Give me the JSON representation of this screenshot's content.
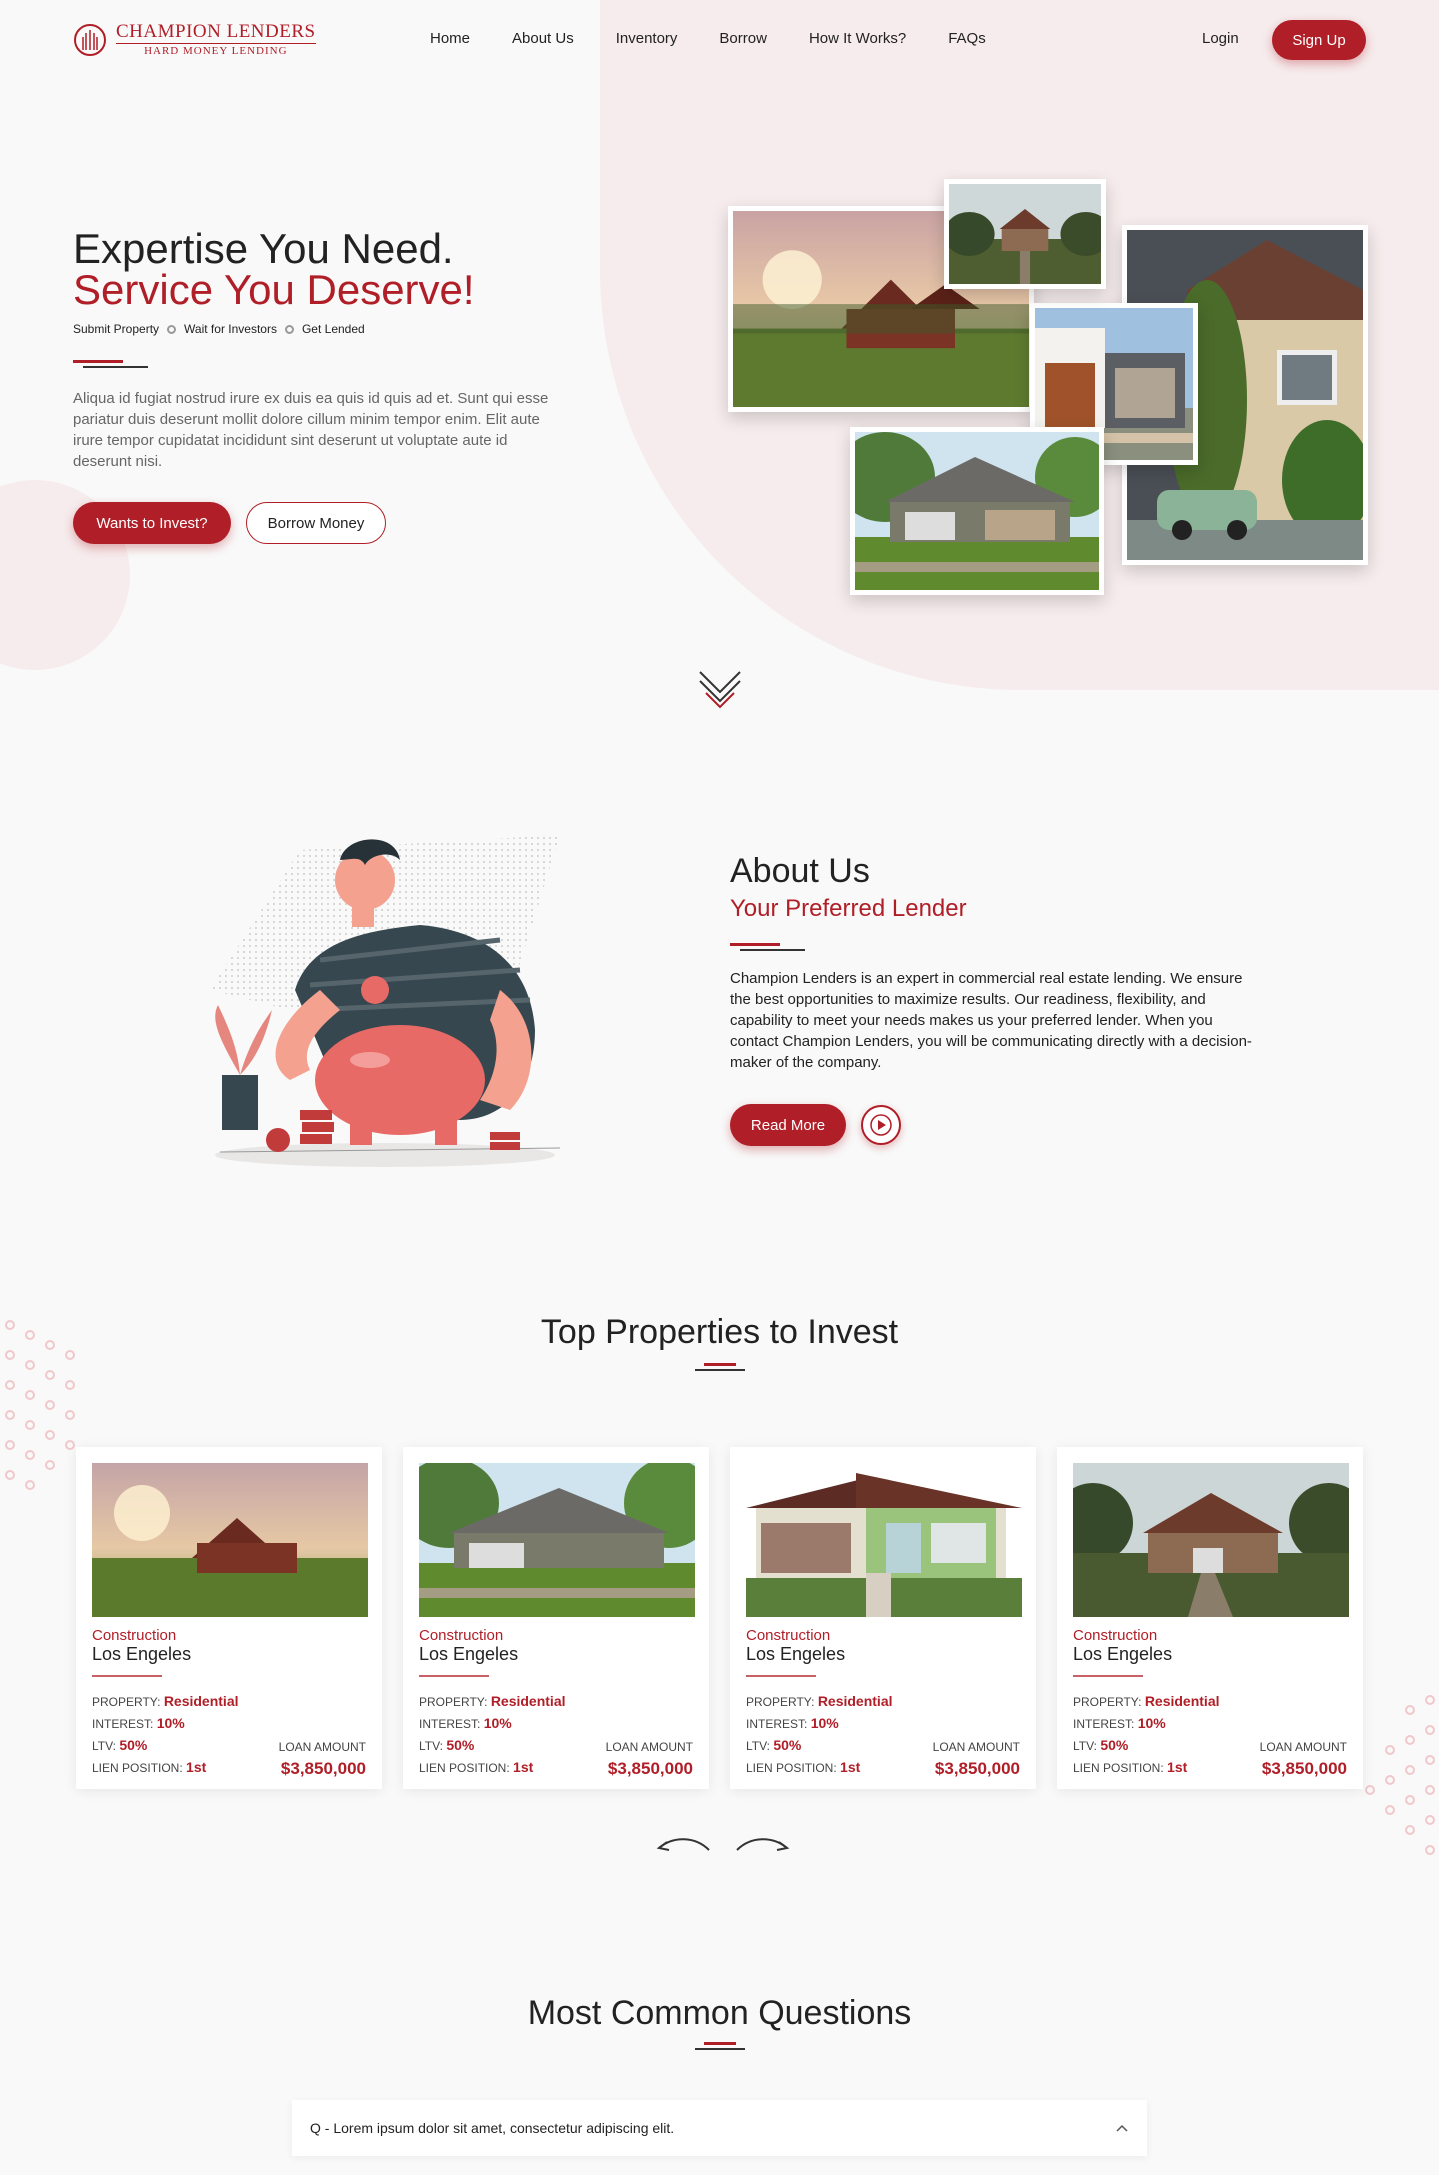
{
  "brand": {
    "name": "CHAMPION LENDERS",
    "tagline": "HARD MONEY LENDING"
  },
  "nav": {
    "items": [
      "Home",
      "About Us",
      "Inventory",
      "Borrow",
      "How It Works?",
      "FAQs"
    ],
    "login": "Login",
    "signup": "Sign Up"
  },
  "hero": {
    "title_line1": "Expertise You Need.",
    "title_line2": "Service You Deserve!",
    "steps": [
      "Submit Property",
      "Wait for Investors",
      "Get Lended"
    ],
    "text": "Aliqua id fugiat nostrud irure ex duis ea quis id quis ad et. Sunt qui esse pariatur duis deserunt mollit dolore cillum minim tempor enim. Elit aute irure tempor cupidatat incididunt sint deserunt ut voluptate aute id deserunt nisi.",
    "invest_button": "Wants to Invest?",
    "borrow_button": "Borrow Money"
  },
  "about": {
    "title": "About Us",
    "subtitle": "Your Preferred Lender",
    "text": "Champion Lenders is an expert in commercial real estate lending. We ensure the best opportunities to maximize results. Our readiness, flexibility, and capability to meet your needs makes us your preferred lender. When you contact Champion Lenders, you will be communicating directly with a decision-maker of the company.",
    "read_more": "Read More"
  },
  "properties": {
    "title": "Top Properties to Invest",
    "cards": [
      {
        "type": "Construction",
        "city": "Los Engeles",
        "property_label": "PROPERTY:",
        "property": "Residential",
        "interest_label": "INTEREST:",
        "interest": "10%",
        "ltv_label": "LTV:",
        "ltv": "50%",
        "lien_label": "LIEN POSITION:",
        "lien": "1st",
        "loan_label": "LOAN AMOUNT",
        "loan": "$3,850,000"
      },
      {
        "type": "Construction",
        "city": "Los Engeles",
        "property_label": "PROPERTY:",
        "property": "Residential",
        "interest_label": "INTEREST:",
        "interest": "10%",
        "ltv_label": "LTV:",
        "ltv": "50%",
        "lien_label": "LIEN POSITION:",
        "lien": "1st",
        "loan_label": "LOAN AMOUNT",
        "loan": "$3,850,000"
      },
      {
        "type": "Construction",
        "city": "Los Engeles",
        "property_label": "PROPERTY:",
        "property": "Residential",
        "interest_label": "INTEREST:",
        "interest": "10%",
        "ltv_label": "LTV:",
        "ltv": "50%",
        "lien_label": "LIEN POSITION:",
        "lien": "1st",
        "loan_label": "LOAN AMOUNT",
        "loan": "$3,850,000"
      },
      {
        "type": "Construction",
        "city": "Los Engeles",
        "property_label": "PROPERTY:",
        "property": "Residential",
        "interest_label": "INTEREST:",
        "interest": "10%",
        "ltv_label": "LTV:",
        "ltv": "50%",
        "lien_label": "LIEN POSITION:",
        "lien": "1st",
        "loan_label": "LOAN AMOUNT",
        "loan": "$3,850,000"
      }
    ]
  },
  "faq": {
    "title": "Most Common Questions",
    "items": [
      {
        "question": "Q - Lorem ipsum dolor sit amet, consectetur adipiscing elit."
      }
    ]
  },
  "colors": {
    "accent": "#b01e27",
    "background": "#f9f9f9",
    "blob": "#f6eced"
  },
  "icons": [
    "logo-emblem-icon",
    "chevron-down-icon",
    "play-icon",
    "arrow-left-icon",
    "arrow-right-icon",
    "caret-up-icon"
  ]
}
